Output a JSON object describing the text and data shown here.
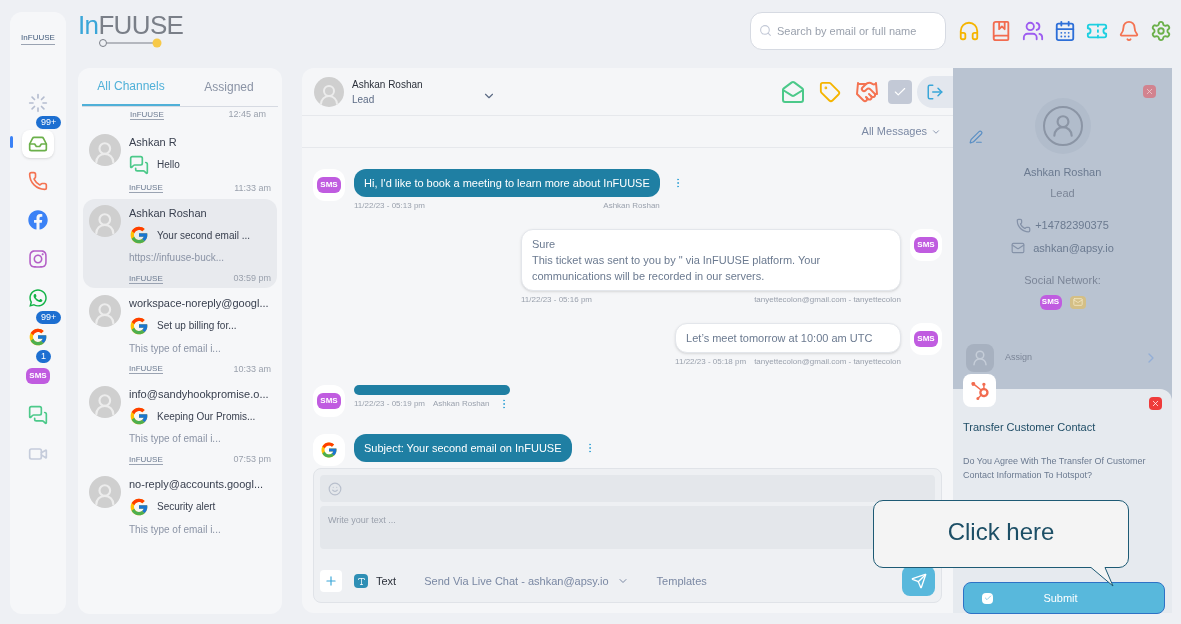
{
  "brand": {
    "accent": "In",
    "rest": "FUUSE"
  },
  "rail": {
    "logo": "InFUUSE",
    "items": [
      {
        "kind": "loader",
        "selected": false
      },
      {
        "kind": "inbox",
        "selected": true,
        "badge": "99+"
      },
      {
        "kind": "phone",
        "selected": false
      },
      {
        "kind": "facebook",
        "selected": false
      },
      {
        "kind": "instagram",
        "selected": false
      },
      {
        "kind": "whatsapp",
        "selected": false
      },
      {
        "kind": "google",
        "selected": false,
        "badge": "99+"
      },
      {
        "kind": "sms",
        "selected": false,
        "badge": "1",
        "label": "SMS"
      },
      {
        "kind": "livechat",
        "selected": false
      },
      {
        "kind": "video",
        "selected": false
      }
    ]
  },
  "search": {
    "placeholder": "Search by email or full name"
  },
  "top_icons": [
    {
      "kind": "headset"
    },
    {
      "kind": "bookmark"
    },
    {
      "kind": "team"
    },
    {
      "kind": "calendar"
    },
    {
      "kind": "ticket"
    },
    {
      "kind": "bell"
    },
    {
      "kind": "settings"
    }
  ],
  "conversation_tabs": [
    {
      "label": "All Channels",
      "selected": true
    },
    {
      "label": "Assigned",
      "selected": false
    }
  ],
  "conversation_head": {
    "logo": "InFUUSE",
    "time": "12:45 am"
  },
  "conversations": [
    {
      "name": "Ashkan R",
      "channel": {
        "kind": "livechat"
      },
      "preview": "Hello",
      "logo": "InFUUSE",
      "time": "11:33 am",
      "selected": false
    },
    {
      "name": "Ashkan Roshan",
      "channel": {
        "kind": "google"
      },
      "preview": "Your second email ...",
      "snippet": "https://infuuse-buck...",
      "logo": "InFUUSE",
      "time": "03:59 pm",
      "selected": true
    },
    {
      "name": "workspace-noreply@googl...",
      "channel": {
        "kind": "google"
      },
      "preview": "Set up billing for...",
      "snippet": "This type of email i...",
      "logo": "InFUUSE",
      "time": "10:33 am",
      "selected": false
    },
    {
      "name": "info@sandyhookpromise.o...",
      "channel": {
        "kind": "google"
      },
      "preview": "Keeping Our Promis...",
      "snippet": "This type of email i...",
      "logo": "InFUUSE",
      "time": "07:53 pm",
      "selected": false
    },
    {
      "name": "no-reply@accounts.googl...",
      "channel": {
        "kind": "google"
      },
      "preview": "Security alert",
      "snippet": "This type of email i...",
      "selected": false
    }
  ],
  "chat": {
    "name": "Ashkan Roshan",
    "role": "Lead",
    "actions": [
      {
        "kind": "mail"
      },
      {
        "kind": "tag"
      },
      {
        "kind": "handshake"
      },
      {
        "kind": "check"
      },
      {
        "kind": "exit"
      }
    ],
    "filter": "All Messages"
  },
  "messages": [
    {
      "kind": "incoming",
      "channel": {
        "kind": "sms",
        "label": "SMS"
      },
      "lines": [
        "Hi, I'd like to book a meeting to learn more about InFUUSE"
      ],
      "date": "11/22/23 - 05:13 pm",
      "author": "Ashkan Roshan"
    },
    {
      "kind": "outgoing",
      "channel": {
        "kind": "sms",
        "label": "SMS"
      },
      "lines": [
        "Sure",
        "This ticket was sent to you by \" via InFUUSE platform. Your communications will be recorded in our servers."
      ],
      "date": "11/22/23 - 05:16 pm",
      "author": "tanyettecolon@gmail.com - tanyettecolon"
    },
    {
      "kind": "outgoing",
      "channel": {
        "kind": "sms",
        "label": "SMS"
      },
      "lines": [
        "Let’s meet tomorrow at 10:00 am UTC"
      ],
      "date": "11/22/23 - 05:18 pm",
      "author": "tanyettecolon@gmail.com - tanyettecolon"
    },
    {
      "kind": "incoming",
      "channel": {
        "kind": "sms",
        "label": "SMS"
      },
      "date": "11/22/23 - 05:19 pm",
      "author": "Ashkan Roshan"
    },
    {
      "kind": "incoming",
      "channel": {
        "kind": "google"
      },
      "lines": [
        "Subject: Your second email on InFUUSE"
      ]
    }
  ],
  "composer": {
    "placeholder": "Write your text ...",
    "mode": "Text",
    "send_via": "Send Via Live Chat - ashkan@apsy.io",
    "templates": "Templates"
  },
  "contact": {
    "name": "Ashkan Roshan",
    "role": "Lead",
    "phone": "+14782390375",
    "email": "ashkan@apsy.io",
    "social_label": "Social Network:",
    "social": [
      {
        "kind": "sms",
        "label": "SMS"
      },
      {
        "kind": "email"
      }
    ],
    "assign": "Assign"
  },
  "popup": {
    "title": "Transfer Customer Contact",
    "body": "Do You Agree With The Transfer Of Customer Contact Information To Hotspot?",
    "submit": "Submit",
    "checked": true
  },
  "callout": {
    "text": "Click here"
  }
}
